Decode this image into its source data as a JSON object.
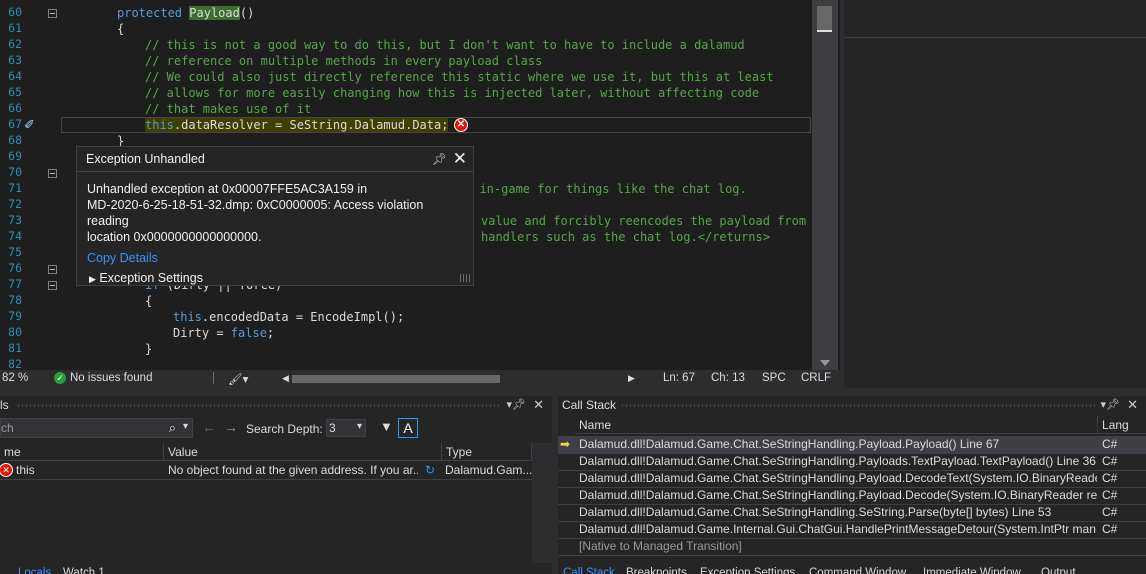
{
  "editor": {
    "lines": [
      {
        "n": "60",
        "html": "<span class='kw'>protected</span> <span class='hl-name'>Payload</span>()",
        "indent": 56
      },
      {
        "n": "61",
        "html": "{",
        "indent": 56
      },
      {
        "n": "62",
        "html": "<span class='cm'>// this is not a good way to do this, but I don't want to have to include a dalamud</span>",
        "indent": 84
      },
      {
        "n": "63",
        "html": "<span class='cm'>// reference on multiple methods in every payload class</span>",
        "indent": 84
      },
      {
        "n": "64",
        "html": "<span class='cm'>// We could also just directly reference this static where we use it, but this at least</span>",
        "indent": 84
      },
      {
        "n": "65",
        "html": "<span class='cm'>// allows for more easily changing how this is injected later, without affecting code</span>",
        "indent": 84
      },
      {
        "n": "66",
        "html": "<span class='cm'>// that makes use of it</span>",
        "indent": 84
      },
      {
        "n": "67",
        "html": "<span class='selbg'><span class='kw'>this</span>.dataResolver = SeString.Dalamud.Data;</span>",
        "indent": 84
      },
      {
        "n": "68",
        "html": "}",
        "indent": 56
      },
      {
        "n": "69",
        "html": "",
        "indent": 56
      },
      {
        "n": "70",
        "html": "",
        "indent": 56
      },
      {
        "n": "71",
        "html": "<span class='cm'>e in-game for things like the chat log.</span>",
        "indent": 404
      },
      {
        "n": "72",
        "html": "",
        "indent": 56
      },
      {
        "n": "73",
        "html": "<span class='cm'>value and forcibly reencodes the payload from it</span>",
        "indent": 420
      },
      {
        "n": "74",
        "html": "<span class='cm'>handlers such as the chat log.&lt;/returns&gt;</span>",
        "indent": 420
      },
      {
        "n": "75",
        "html": "",
        "indent": 56
      },
      {
        "n": "76",
        "html": "",
        "indent": 56
      },
      {
        "n": "77",
        "html": "<span class='kw'>if</span> (Dirty || force)",
        "indent": 84
      },
      {
        "n": "78",
        "html": "{",
        "indent": 84
      },
      {
        "n": "79",
        "html": "<span class='kw'>this</span>.encodedData = EncodeImpl();",
        "indent": 112
      },
      {
        "n": "80",
        "html": "Dirty = <span class='kw'>false</span>;",
        "indent": 112
      },
      {
        "n": "81",
        "html": "}",
        "indent": 84
      },
      {
        "n": "82",
        "html": "",
        "indent": 84
      }
    ]
  },
  "status": {
    "zoom": "82 %",
    "issues": "No issues found",
    "ln": "Ln: 67",
    "ch": "Ch: 13",
    "spc": "SPC",
    "crlf": "CRLF"
  },
  "popup": {
    "title": "Exception Unhandled",
    "message_1": "Unhandled exception at 0x00007FFE5AC3A159 in",
    "message_2": "MD-2020-6-25-18-51-32.dmp: 0xC0000005: Access violation reading",
    "message_3": "location 0x0000000000000000.",
    "copy_details": "Copy Details",
    "exception_settings": "Exception Settings"
  },
  "locals": {
    "title": "ls",
    "search_placeholder": "ch",
    "search_depth_label": "Search Depth:",
    "search_depth_value": "3",
    "columns": {
      "name": "me",
      "value": "Value",
      "type": "Type"
    },
    "rows": [
      {
        "name": "this",
        "value": "No object found at the given address. If you ar...",
        "type": "Dalamud.Gam..."
      }
    ],
    "tabs": [
      "Locals",
      "Watch 1"
    ]
  },
  "callstack": {
    "title": "Call Stack",
    "columns": {
      "name": "Name",
      "lang": "Lang"
    },
    "rows": [
      {
        "name": "Dalamud.dll!Dalamud.Game.Chat.SeStringHandling.Payload.Payload() Line 67",
        "lang": "C#"
      },
      {
        "name": "Dalamud.dll!Dalamud.Game.Chat.SeStringHandling.Payloads.TextPayload.TextPayload() Line 36",
        "lang": "C#"
      },
      {
        "name": "Dalamud.dll!Dalamud.Game.Chat.SeStringHandling.Payload.DecodeText(System.IO.BinaryReade...",
        "lang": "C#"
      },
      {
        "name": "Dalamud.dll!Dalamud.Game.Chat.SeStringHandling.Payload.Decode(System.IO.BinaryReader rea...",
        "lang": "C#"
      },
      {
        "name": "Dalamud.dll!Dalamud.Game.Chat.SeStringHandling.SeString.Parse(byte[] bytes) Line 53",
        "lang": "C#"
      },
      {
        "name": "Dalamud.dll!Dalamud.Game.Internal.Gui.ChatGui.HandlePrintMessageDetour(System.IntPtr man...",
        "lang": "C#"
      },
      {
        "name": "[Native to Managed Transition]",
        "lang": ""
      }
    ],
    "tabs": [
      "Call Stack",
      "Breakpoints",
      "Exception Settings",
      "Command Window",
      "Immediate Window",
      "Output"
    ]
  }
}
